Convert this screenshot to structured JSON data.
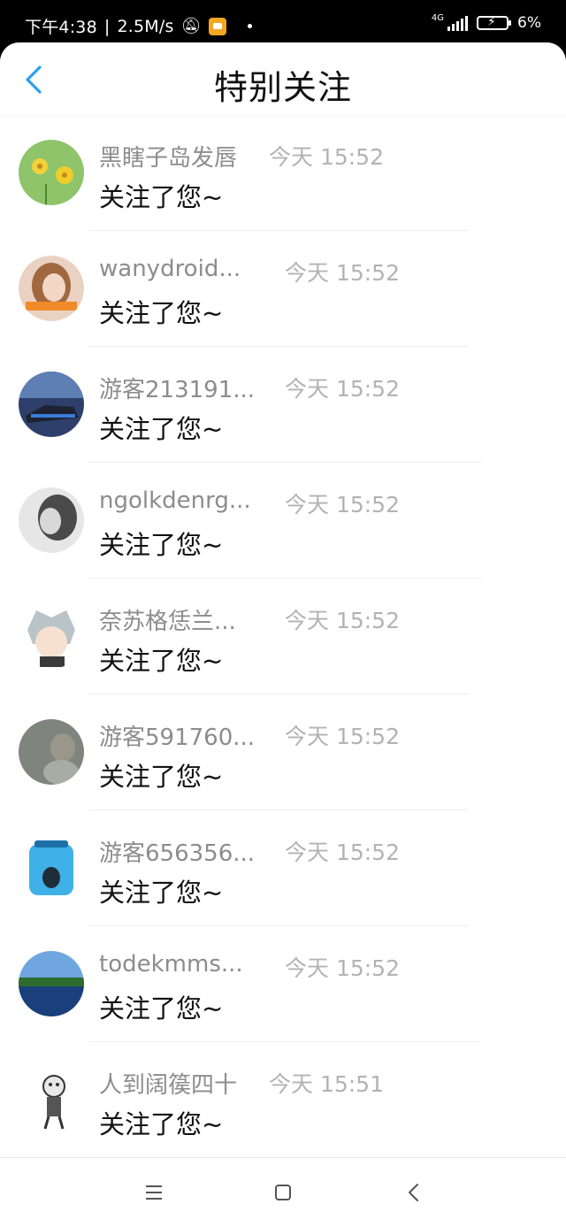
{
  "status_bar": {
    "time": "下午4:38",
    "speed": "2.5M/s",
    "network": "4G",
    "battery": "6%"
  },
  "header": {
    "title": "特别关注"
  },
  "items": [
    {
      "name": "黑瞎子岛发唇",
      "time": "今天 15:52",
      "message": "关注了您~"
    },
    {
      "name": "wanydroid...",
      "time": "今天 15:52",
      "message": "关注了您~"
    },
    {
      "name": "游客213191...",
      "time": "今天 15:52",
      "message": "关注了您~"
    },
    {
      "name": "ngolkdenrg...",
      "time": "今天 15:52",
      "message": "关注了您~"
    },
    {
      "name": "奈苏格恁兰...",
      "time": "今天 15:52",
      "message": "关注了您~"
    },
    {
      "name": "游客591760...",
      "time": "今天 15:52",
      "message": "关注了您~"
    },
    {
      "name": "游客656356...",
      "time": "今天 15:52",
      "message": "关注了您~"
    },
    {
      "name": "todekmms...",
      "time": "今天 15:52",
      "message": "关注了您~"
    },
    {
      "name": "人到阔篌四十",
      "time": "今天 15:51",
      "message": "关注了您~"
    }
  ],
  "colors": {
    "accent": "#2b9ff0",
    "name_gray": "#8c8c8c",
    "time_gray": "#b3b3b3"
  }
}
